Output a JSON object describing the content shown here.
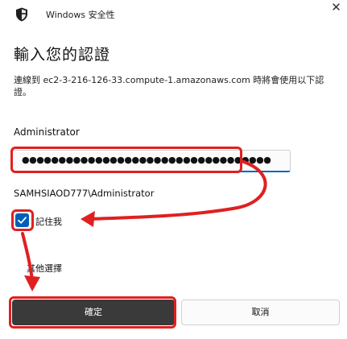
{
  "window": {
    "title": "Windows 安全性",
    "close_glyph": "✕"
  },
  "dialog": {
    "heading": "輸入您的認證",
    "description": "連線到 ec2-3-216-126-33.compute-1.amazonaws.com 時將會使用以下認證。",
    "username_label": "Administrator",
    "password_value": "●●●●●●●●●●●●●●●●●●●●●●●●●●●●●●●●●●",
    "account_name": "SAMHSIAOD777\\Administrator",
    "remember_label": "記住我",
    "remember_checked": true,
    "more_choices": "其他選擇",
    "ok_label": "確定",
    "cancel_label": "取消"
  },
  "icons": {
    "title_icon": "shield-icon",
    "checkbox_icon": "checkmark-icon"
  },
  "colors": {
    "accent": "#005fb8",
    "ok_button": "#3a3a3a",
    "annotation": "#e02020"
  }
}
